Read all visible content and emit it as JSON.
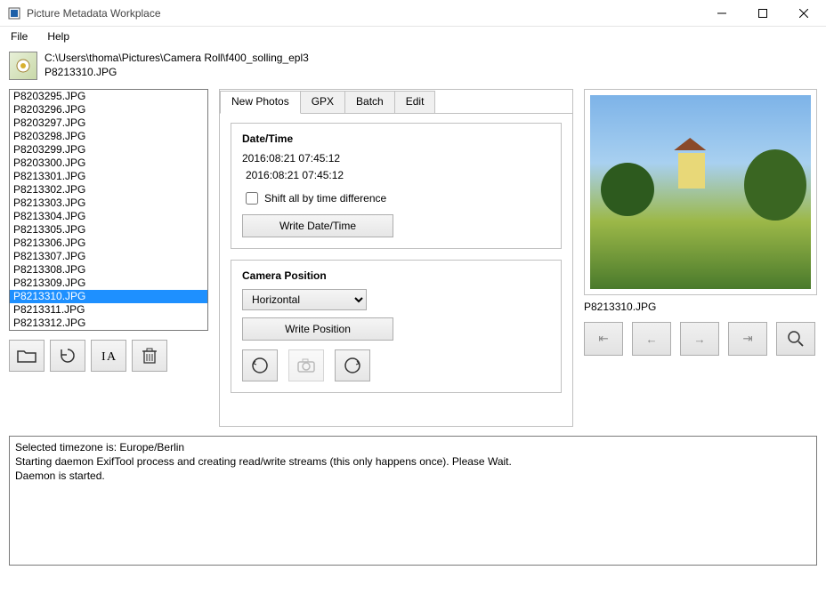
{
  "window": {
    "title": "Picture Metadata Workplace"
  },
  "menu": {
    "file": "File",
    "help": "Help"
  },
  "header": {
    "path": "C:\\Users\\thoma\\Pictures\\Camera Roll\\f400_solling_epl3",
    "filename": "P8213310.JPG"
  },
  "file_list": {
    "items": [
      "P8203295.JPG",
      "P8203296.JPG",
      "P8203297.JPG",
      "P8203298.JPG",
      "P8203299.JPG",
      "P8203300.JPG",
      "P8213301.JPG",
      "P8213302.JPG",
      "P8213303.JPG",
      "P8213304.JPG",
      "P8213305.JPG",
      "P8213306.JPG",
      "P8213307.JPG",
      "P8213308.JPG",
      "P8213309.JPG",
      "P8213310.JPG",
      "P8213311.JPG",
      "P8213312.JPG"
    ],
    "selected_index": 15
  },
  "tabs": {
    "items": [
      "New Photos",
      "GPX",
      "Batch",
      "Edit"
    ],
    "active_index": 0
  },
  "datetime_group": {
    "title": "Date/Time",
    "original": "2016:08:21 07:45:12",
    "editable": "2016:08:21 07:45:12",
    "shift_label": "Shift all by time difference",
    "write_button": "Write Date/Time"
  },
  "camera_group": {
    "title": "Camera Position",
    "orientation_selected": "Horizontal",
    "write_button": "Write Position"
  },
  "preview": {
    "filename": "P8213310.JPG"
  },
  "nav": {
    "first": "⇤",
    "prev": "←",
    "next": "→",
    "last": "⇥"
  },
  "log": {
    "line1": "Selected timezone is: Europe/Berlin",
    "line2": "Starting daemon ExifTool process and creating read/write streams (this only happens once). Please Wait.",
    "line3": "Daemon is started."
  }
}
